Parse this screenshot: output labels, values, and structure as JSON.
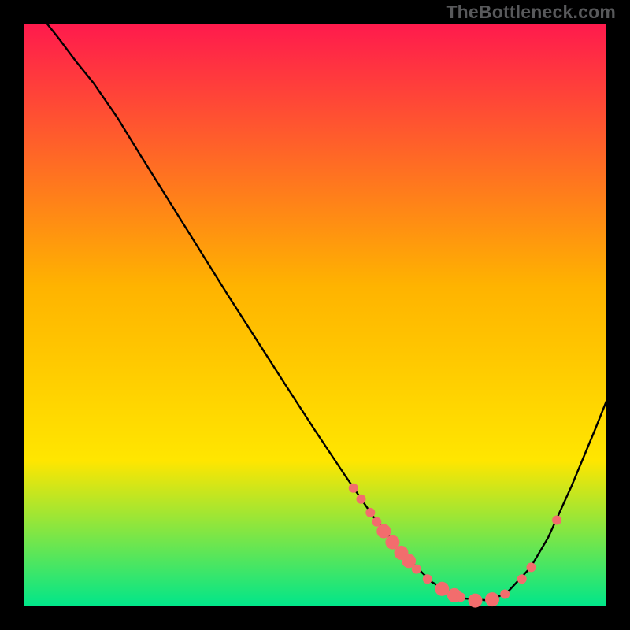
{
  "watermark": "TheBottleneck.com",
  "chart_data": {
    "type": "line",
    "title": "",
    "xlabel": "",
    "ylabel": "",
    "xlim": [
      0,
      100
    ],
    "ylim": [
      0,
      100
    ],
    "background_gradient": {
      "top": "#ff1a4d",
      "mid1": "#ffb300",
      "mid2": "#ffe600",
      "bottom": "#00e68a"
    },
    "series": [
      {
        "name": "curve",
        "stroke": "#000000",
        "points": [
          {
            "x": 4.0,
            "y": 100.0
          },
          {
            "x": 6.0,
            "y": 97.5
          },
          {
            "x": 9.0,
            "y": 93.5
          },
          {
            "x": 12.0,
            "y": 89.8
          },
          {
            "x": 16.0,
            "y": 84.0
          },
          {
            "x": 20.0,
            "y": 77.5
          },
          {
            "x": 25.0,
            "y": 69.5
          },
          {
            "x": 30.0,
            "y": 61.5
          },
          {
            "x": 35.0,
            "y": 53.5
          },
          {
            "x": 40.0,
            "y": 45.7
          },
          {
            "x": 45.0,
            "y": 37.9
          },
          {
            "x": 50.0,
            "y": 30.2
          },
          {
            "x": 55.0,
            "y": 22.7
          },
          {
            "x": 60.0,
            "y": 15.4
          },
          {
            "x": 65.0,
            "y": 9.1
          },
          {
            "x": 70.0,
            "y": 4.2
          },
          {
            "x": 75.0,
            "y": 1.4
          },
          {
            "x": 80.0,
            "y": 1.0
          },
          {
            "x": 83.0,
            "y": 2.4
          },
          {
            "x": 87.0,
            "y": 6.7
          },
          {
            "x": 90.0,
            "y": 11.8
          },
          {
            "x": 94.0,
            "y": 20.6
          },
          {
            "x": 98.0,
            "y": 30.2
          },
          {
            "x": 100.0,
            "y": 35.2
          }
        ]
      },
      {
        "name": "dots",
        "fill": "#f26d6d",
        "points": [
          {
            "x": 56.6,
            "y": 20.3,
            "r": 6
          },
          {
            "x": 57.9,
            "y": 18.4,
            "r": 6
          },
          {
            "x": 59.5,
            "y": 16.1,
            "r": 6
          },
          {
            "x": 60.6,
            "y": 14.5,
            "r": 6
          },
          {
            "x": 61.8,
            "y": 12.9,
            "r": 9
          },
          {
            "x": 63.3,
            "y": 11.0,
            "r": 9
          },
          {
            "x": 64.8,
            "y": 9.2,
            "r": 9
          },
          {
            "x": 66.1,
            "y": 7.8,
            "r": 9
          },
          {
            "x": 67.4,
            "y": 6.4,
            "r": 6
          },
          {
            "x": 69.3,
            "y": 4.7,
            "r": 6
          },
          {
            "x": 71.8,
            "y": 3.0,
            "r": 9
          },
          {
            "x": 73.9,
            "y": 1.9,
            "r": 9
          },
          {
            "x": 75.0,
            "y": 1.6,
            "r": 6
          },
          {
            "x": 77.5,
            "y": 1.0,
            "r": 9
          },
          {
            "x": 80.4,
            "y": 1.2,
            "r": 9
          },
          {
            "x": 82.6,
            "y": 2.1,
            "r": 6
          },
          {
            "x": 85.5,
            "y": 4.7,
            "r": 6
          },
          {
            "x": 87.1,
            "y": 6.7,
            "r": 6
          },
          {
            "x": 91.5,
            "y": 14.8,
            "r": 6
          }
        ]
      }
    ]
  }
}
